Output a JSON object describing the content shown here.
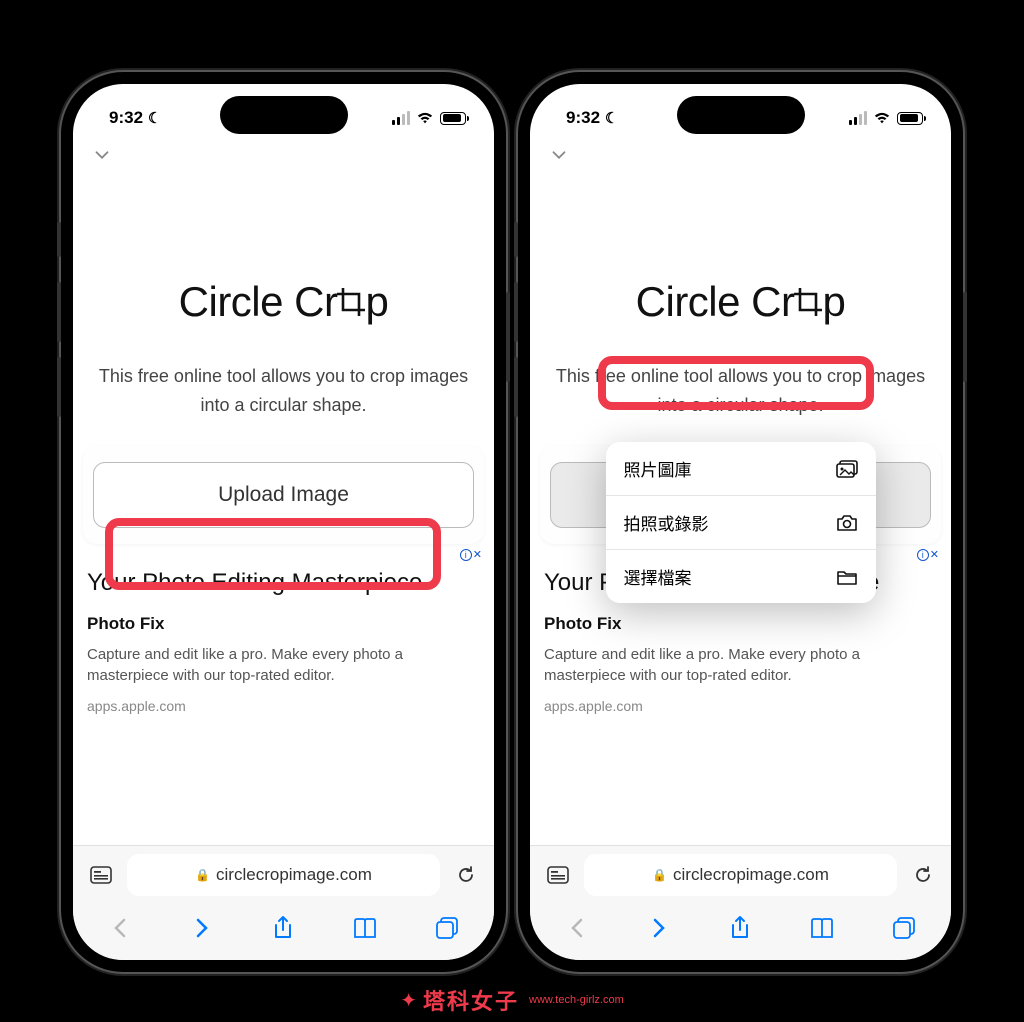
{
  "status": {
    "time": "9:32"
  },
  "page": {
    "heading_pre": "Circle Cr",
    "heading_post": "p",
    "sub": "This free online tool allows you to crop images into a circular shape.",
    "upload_label": "Upload Image"
  },
  "ad": {
    "tag_info": "i",
    "tag_x": "✕",
    "title": "Your Photo Editing Masterpiece",
    "brand": "Photo Fix",
    "desc": "Capture and edit like a pro. Make every photo a masterpiece with our top-rated editor.",
    "url": "apps.apple.com"
  },
  "chrome": {
    "url": "circlecropimage.com"
  },
  "popup": {
    "photo_library": "照片圖庫",
    "camera": "拍照或錄影",
    "choose_file": "選擇檔案"
  },
  "watermark": {
    "name": "塔科女子",
    "url": "www.tech-girlz.com"
  }
}
